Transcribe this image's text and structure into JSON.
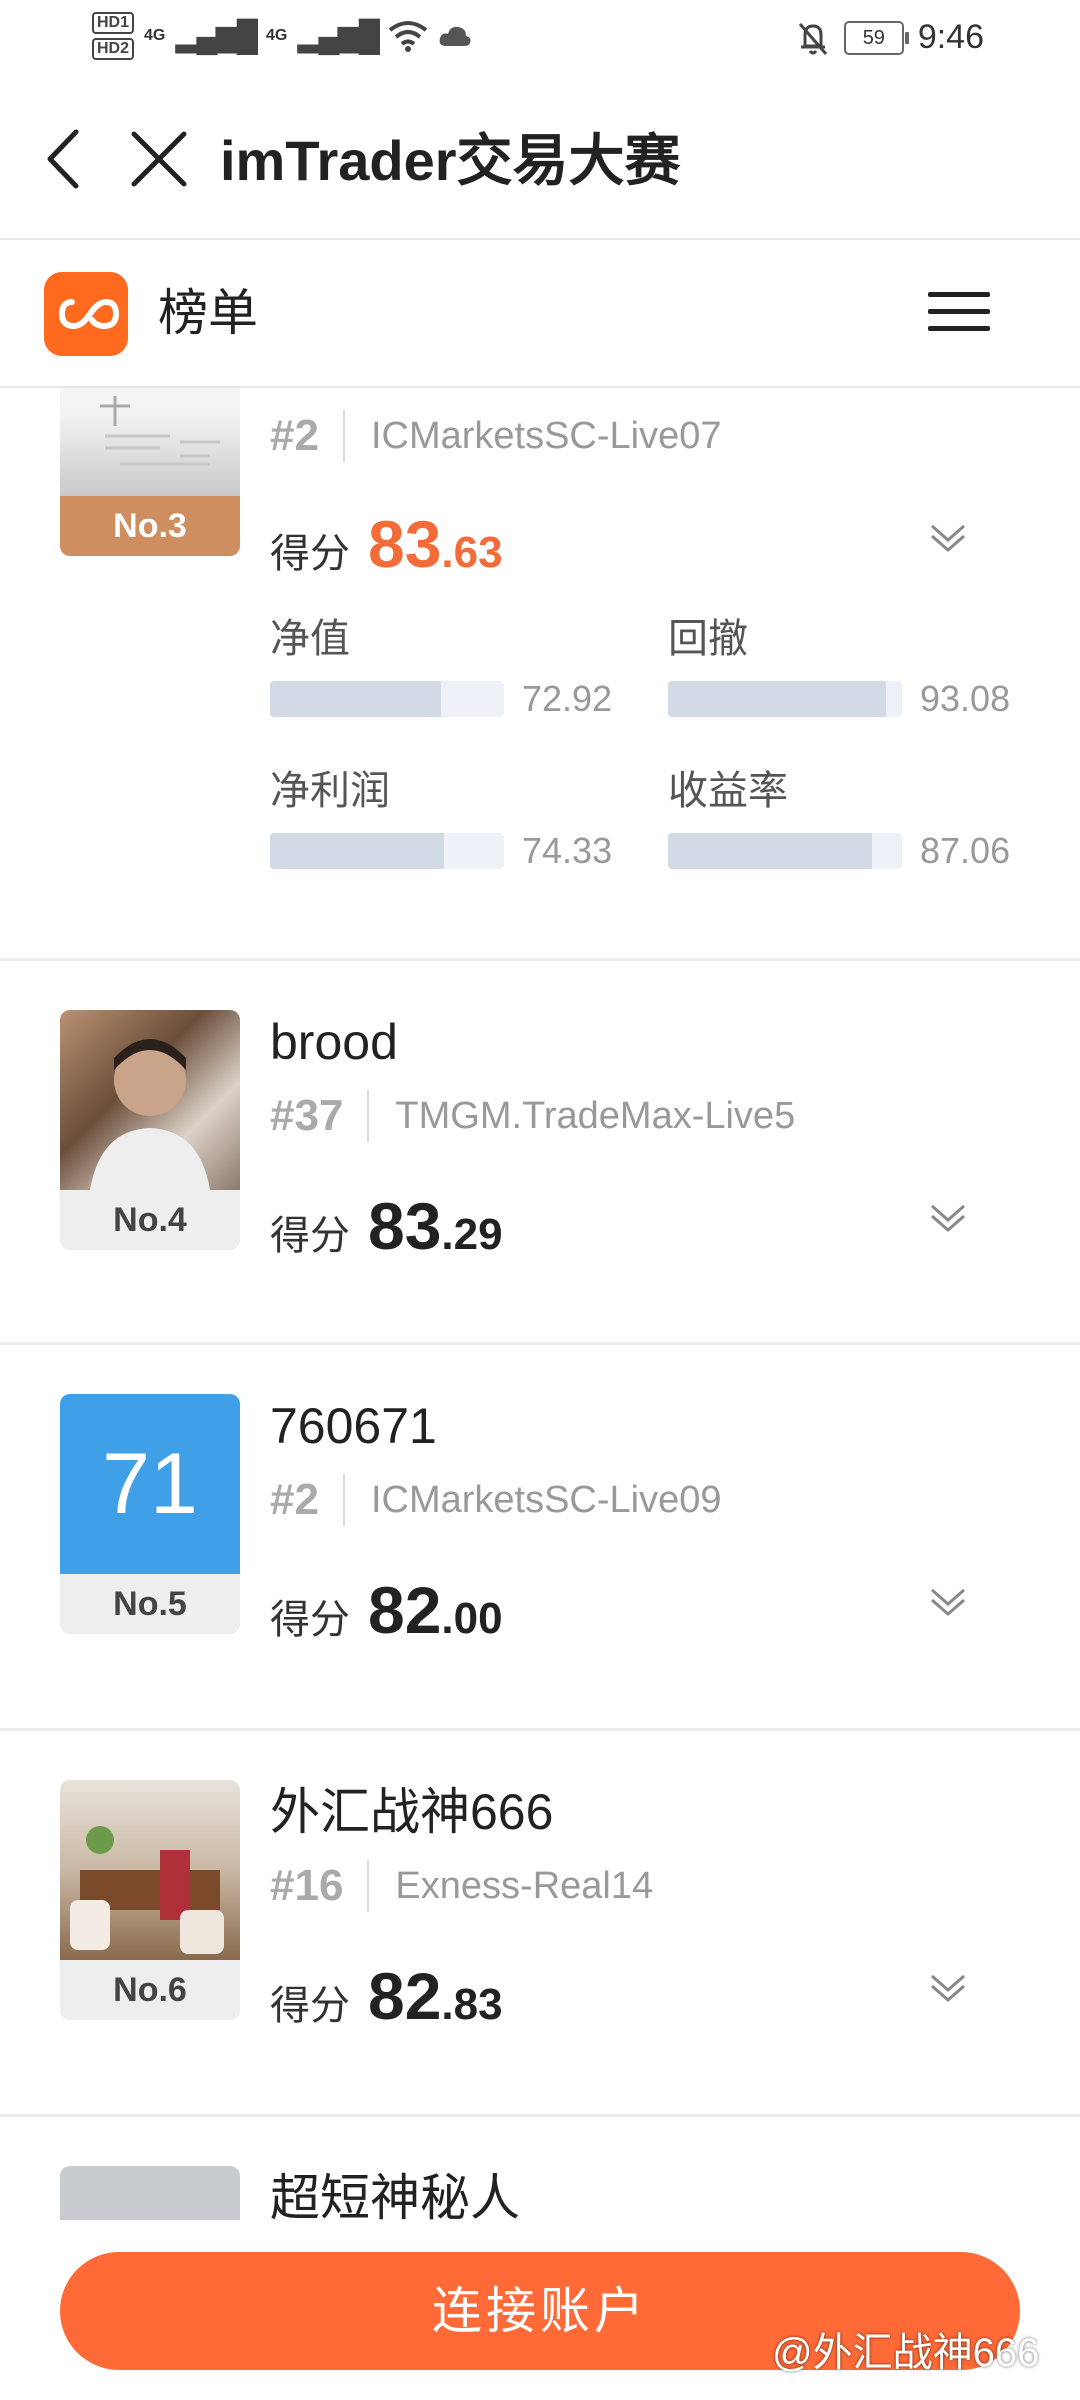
{
  "status_bar": {
    "hd1": "HD1",
    "hd2": "HD2",
    "signal1": "4G",
    "signal2": "4G",
    "battery": "59",
    "time": "9:46"
  },
  "header": {
    "title": "imTrader交易大赛"
  },
  "subheader": {
    "title": "榜单",
    "accent_color": "#ff6a1f"
  },
  "entries": [
    {
      "rank_label": "No.3",
      "meta_rank": "#2",
      "server": "ICMarketsSC-Live07",
      "score_label": "得分",
      "score_int": "83",
      "score_dec": ".63",
      "score_color": "#f26b38",
      "metrics": [
        {
          "label": "净值",
          "value": "72.92",
          "fraction": 0.729
        },
        {
          "label": "回撤",
          "value": "93.08",
          "fraction": 0.931
        },
        {
          "label": "净利润",
          "value": "74.33",
          "fraction": 0.743
        },
        {
          "label": "收益率",
          "value": "87.06",
          "fraction": 0.871
        }
      ]
    },
    {
      "rank_label": "No.4",
      "name": "brood",
      "meta_rank": "#37",
      "server": "TMGM.TradeMax-Live5",
      "score_label": "得分",
      "score_int": "83",
      "score_dec": ".29"
    },
    {
      "rank_label": "No.5",
      "avatar_text": "71",
      "name": "760671",
      "meta_rank": "#2",
      "server": "ICMarketsSC-Live09",
      "score_label": "得分",
      "score_int": "82",
      "score_dec": ".00"
    },
    {
      "rank_label": "No.6",
      "name": "外汇战神666",
      "meta_rank": "#16",
      "server": "Exness-Real14",
      "score_label": "得分",
      "score_int": "82",
      "score_dec": ".83"
    },
    {
      "name": "超短神秘人"
    }
  ],
  "bottom": {
    "connect_label": "连接账户",
    "watermark": "@外汇战神666"
  }
}
